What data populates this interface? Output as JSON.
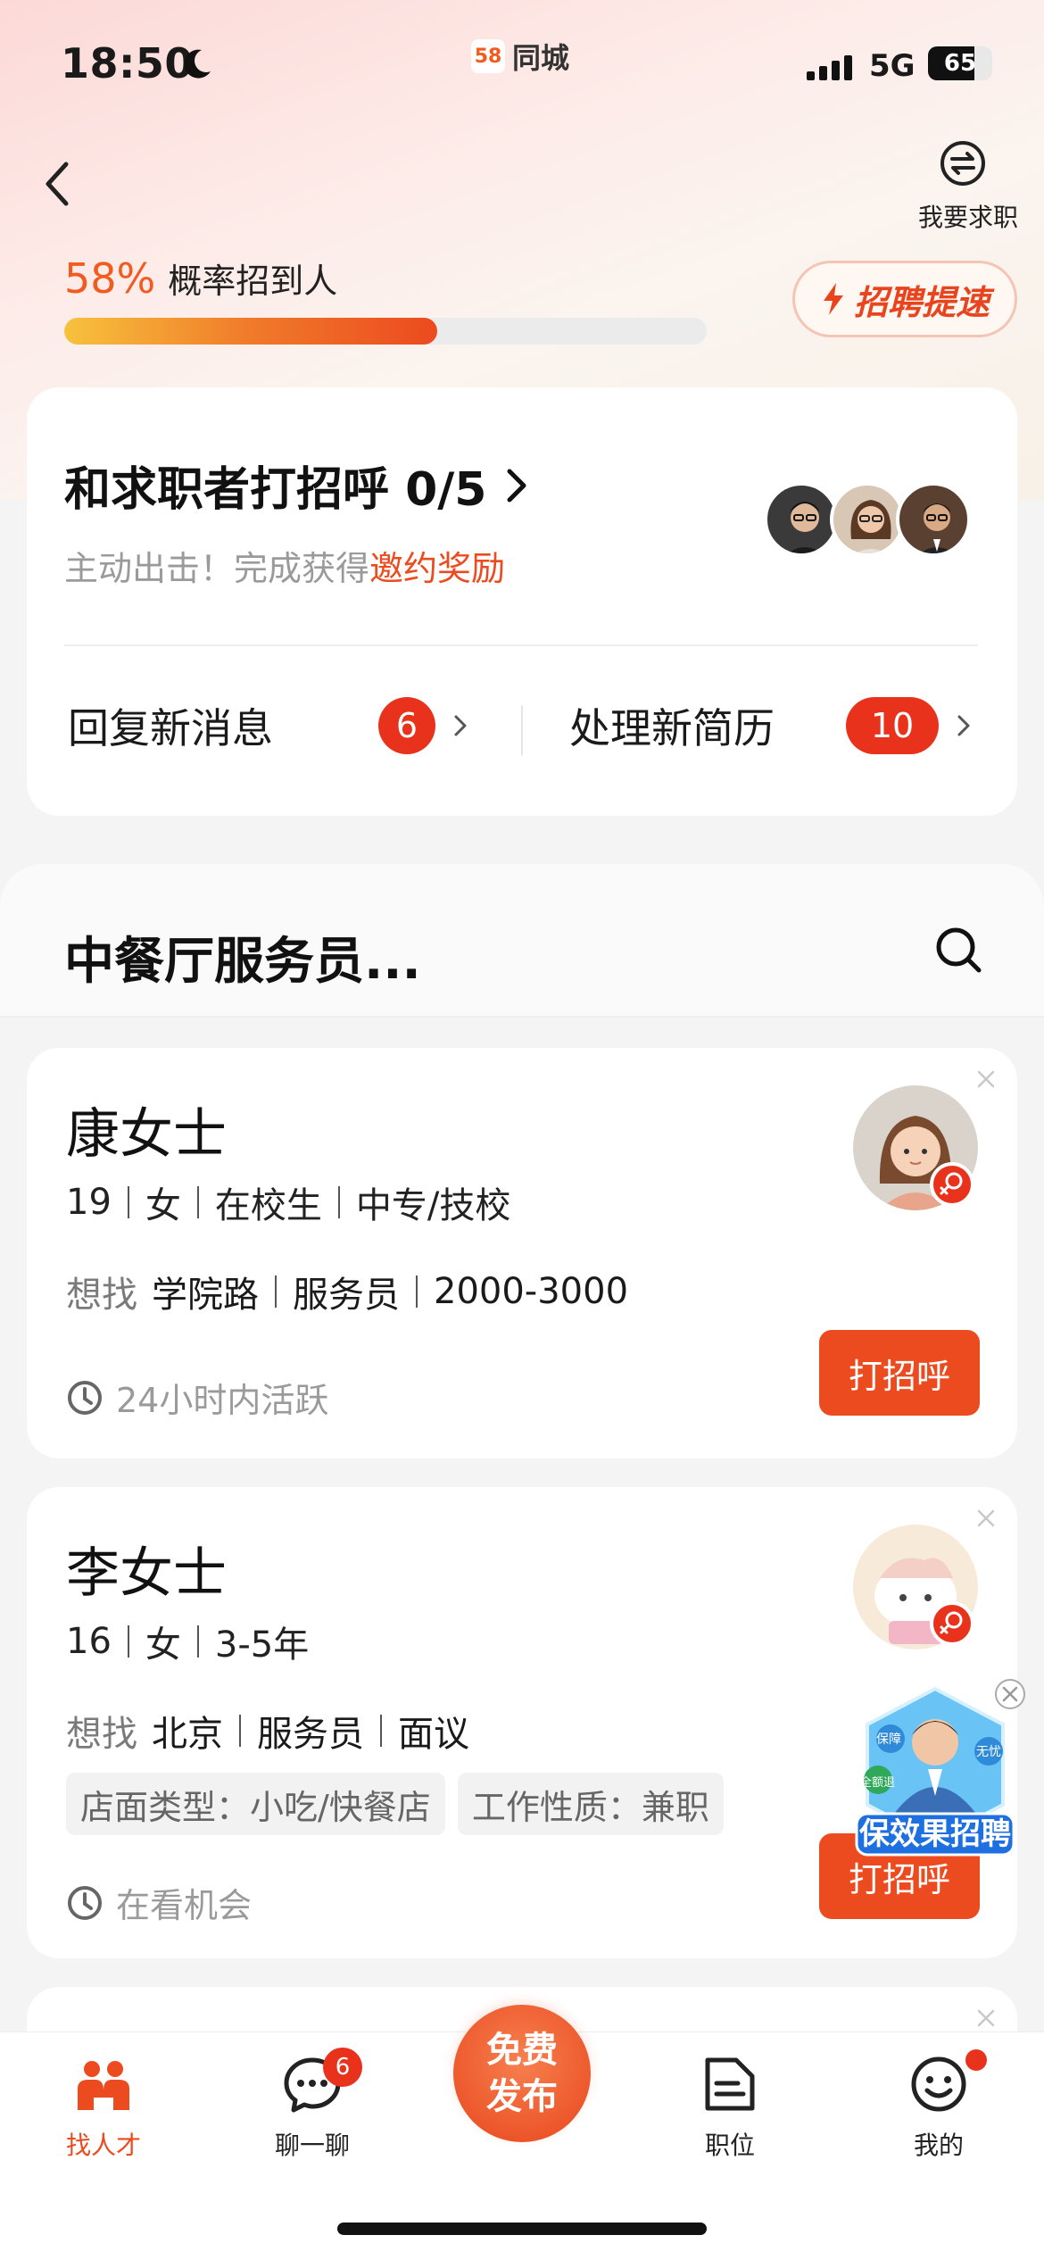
{
  "status_bar": {
    "time": "18:50",
    "brand_logo": "58",
    "brand_name": "同城",
    "network": "5G",
    "battery": "65"
  },
  "header": {
    "switch_label": "我要求职",
    "probability": "58%",
    "probability_label": "概率招到人",
    "probability_value": 0.58,
    "speed_button": "招聘提速"
  },
  "greet_card": {
    "title": "和求职者打招呼 0/5",
    "subtitle_prefix": "主动出击！完成获得",
    "subtitle_highlight": "邀约奖励",
    "reply_label": "回复新消息",
    "reply_count": "6",
    "resume_label": "处理新简历",
    "resume_count": "10"
  },
  "job": {
    "title": "中餐厅服务员..."
  },
  "candidates": [
    {
      "name": "康女士",
      "meta": [
        "19",
        "女",
        "在校生",
        "中专/技校"
      ],
      "want_label": "想找",
      "want": [
        "学院路",
        "服务员",
        "2000-3000"
      ],
      "active": "24小时内活跃",
      "button": "打招呼"
    },
    {
      "name": "李女士",
      "meta": [
        "16",
        "女",
        "3-5年"
      ],
      "want_label": "想找",
      "want": [
        "北京",
        "服务员",
        "面议"
      ],
      "tags": [
        "店面类型：小吃/快餐店",
        "工作性质：兼职"
      ],
      "active": "在看机会",
      "button": "打招呼"
    }
  ],
  "promo": {
    "label": "保效果招聘",
    "chips": [
      "保障",
      "无忧",
      "全额退"
    ]
  },
  "tabbar": {
    "tabs": [
      {
        "label": "找人才",
        "icon": "people-icon"
      },
      {
        "label": "聊一聊",
        "icon": "chat-icon",
        "badge": "6"
      },
      {
        "label": "职位",
        "icon": "document-icon"
      },
      {
        "label": "我的",
        "icon": "smile-icon"
      }
    ],
    "publish_line1": "免费",
    "publish_line2": "发布"
  },
  "colors": {
    "accent": "#ec4a1f",
    "badge": "#e9321c"
  }
}
